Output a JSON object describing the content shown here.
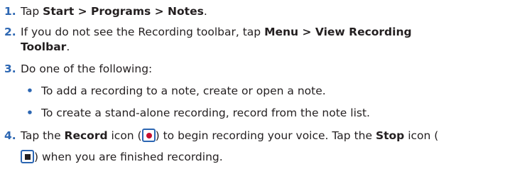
{
  "steps": [
    {
      "number": "1.",
      "pre": "Tap ",
      "bold": "Start > Programs > Notes",
      "post": "."
    },
    {
      "number": "2.",
      "pre": "If you do not see the Recording toolbar, tap ",
      "bold1": "Menu > View Recording",
      "bold2": "Toolbar",
      "post": "."
    },
    {
      "number": "3.",
      "text": "Do one of the following:",
      "bullets": [
        "To add a recording to a note, create or open a note.",
        "To create a stand-alone recording, record from the note list."
      ]
    },
    {
      "number": "4.",
      "pre": "Tap the ",
      "record_label": "Record",
      "mid1": " icon (",
      "mid2": ") to begin recording your voice. Tap the ",
      "stop_label": "Stop",
      "mid3": " icon (",
      "post": ") when you are finished recording."
    }
  ],
  "bullet_glyph": "•",
  "colors": {
    "number": "#2c66b2",
    "text": "#231f20",
    "record_dot": "#c8102e"
  },
  "icons": {
    "record": "record-icon",
    "stop": "stop-icon"
  }
}
